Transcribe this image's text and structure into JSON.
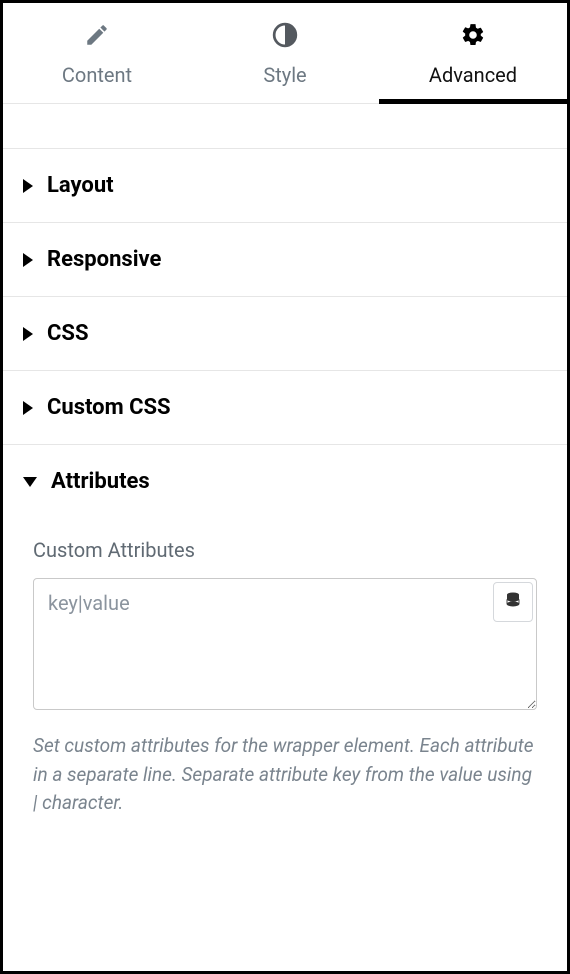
{
  "tabs": {
    "content": "Content",
    "style": "Style",
    "advanced": "Advanced"
  },
  "sections": {
    "layout": "Layout",
    "responsive": "Responsive",
    "css": "CSS",
    "custom_css": "Custom CSS",
    "attributes": "Attributes"
  },
  "attributes_panel": {
    "field_label": "Custom Attributes",
    "placeholder": "key|value",
    "help_text": "Set custom attributes for the wrapper element. Each attribute in a separate line. Separate attribute key from the value using | character."
  }
}
